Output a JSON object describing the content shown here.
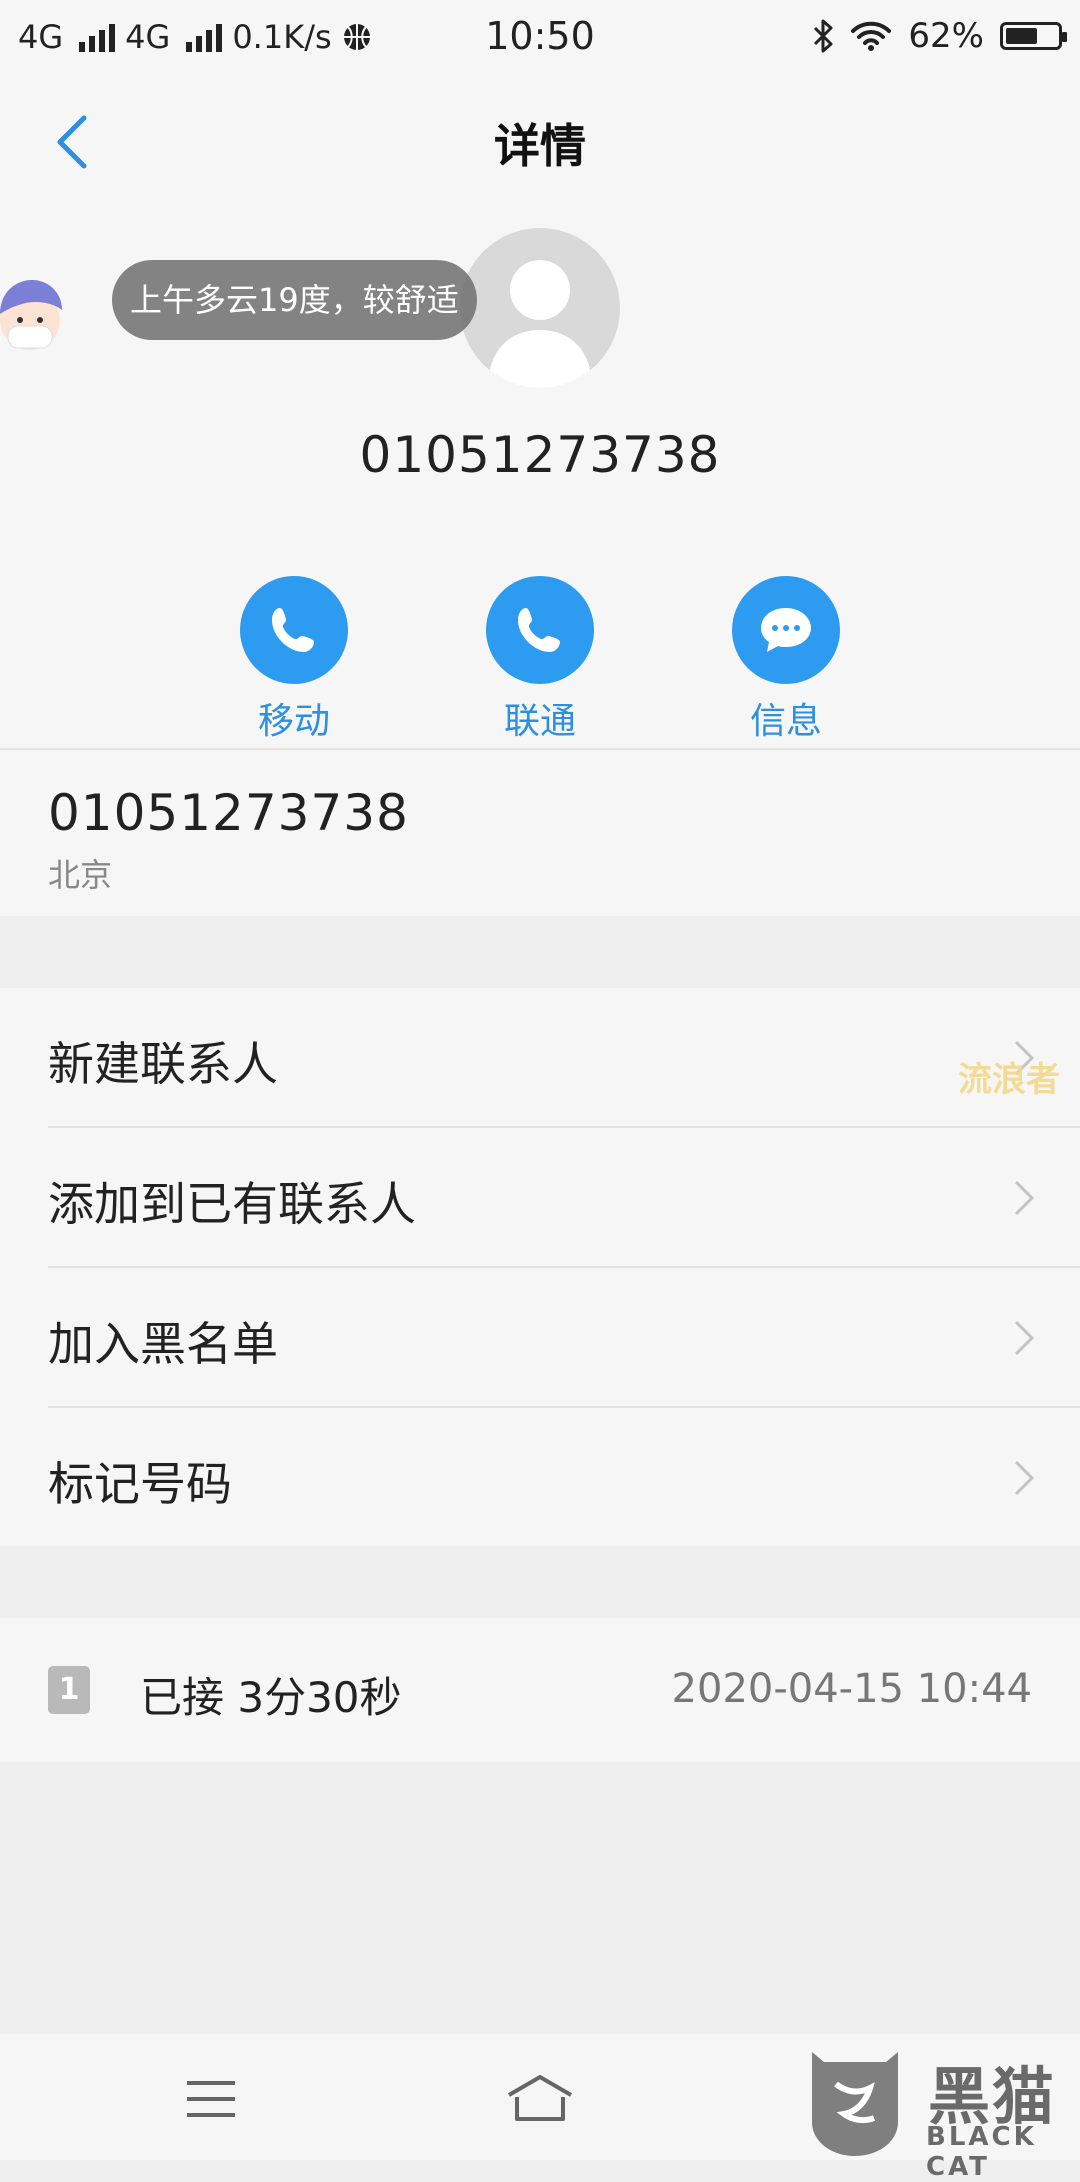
{
  "status_bar": {
    "net1": "4G",
    "net2": "4G",
    "speed": "0.1K/s",
    "time": "10:50",
    "battery": "62%",
    "battery_level": 0.62
  },
  "header": {
    "title": "详情"
  },
  "weather": {
    "text": "上午多云19度，较舒适"
  },
  "contact": {
    "number": "01051273738"
  },
  "actions": [
    {
      "label": "移动",
      "icon": "phone-icon"
    },
    {
      "label": "联通",
      "icon": "phone-icon"
    },
    {
      "label": "信息",
      "icon": "message-icon"
    }
  ],
  "number_info": {
    "number": "01051273738",
    "location": "北京"
  },
  "options": [
    {
      "label": "新建联系人"
    },
    {
      "label": "添加到已有联系人"
    },
    {
      "label": "加入黑名单"
    },
    {
      "label": "标记号码"
    }
  ],
  "watermark": {
    "text": "流浪者"
  },
  "call_log": {
    "sim": "1",
    "status": "已接 3分30秒",
    "datetime": "2020-04-15 10:44"
  },
  "brand": {
    "name": "黑猫",
    "sub": "BLACK CAT"
  },
  "colors": {
    "accent": "#2d9cf0",
    "background": "#efefef",
    "card": "#f6f6f6"
  }
}
